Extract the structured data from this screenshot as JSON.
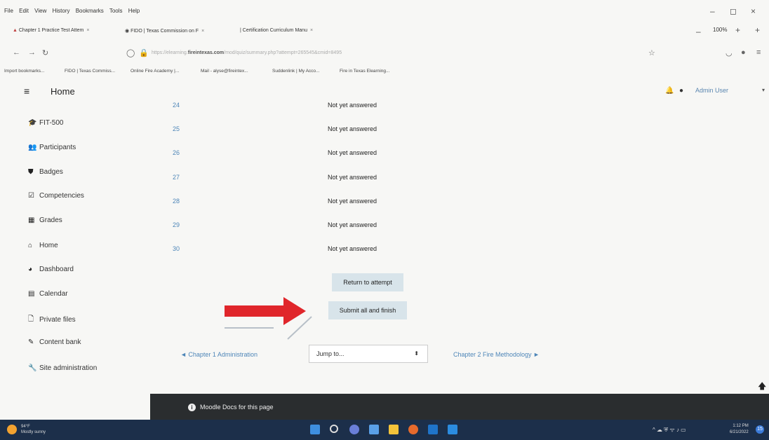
{
  "browser": {
    "menu": [
      "File",
      "Edit",
      "View",
      "History",
      "Bookmarks",
      "Tools",
      "Help"
    ],
    "tabs": [
      {
        "label": "Chapter 1 Practice Test Attem"
      },
      {
        "label": "FIDO | Texas Commission on F"
      },
      {
        "label": "Certification Curriculum Manu"
      }
    ],
    "zoom": "100%",
    "url_prefix": "https://elearning.",
    "url_domain": "fireintexas.com",
    "url_path": "/mod/quiz/summary.php?attempt=265545&cmid=8495",
    "bookmarks": [
      "Import bookmarks...",
      "FIDO | Texas Commiss...",
      "Online Fire Academy |...",
      "Mail - alyse@fireintex...",
      "Suddenlink | My Acco...",
      "Fire in Texas Elearning..."
    ]
  },
  "header": {
    "title": "Home",
    "user": "Admin User"
  },
  "sidebar": {
    "items": [
      {
        "label": "FIT-500",
        "icon": "graduation-cap-icon",
        "glyph": "🎓"
      },
      {
        "label": "Participants",
        "icon": "users-icon",
        "glyph": "👥"
      },
      {
        "label": "Badges",
        "icon": "shield-icon",
        "glyph": "⛊"
      },
      {
        "label": "Competencies",
        "icon": "checkbox-icon",
        "glyph": "☑"
      },
      {
        "label": "Grades",
        "icon": "table-icon",
        "glyph": "▦"
      },
      {
        "label": "Home",
        "icon": "home-icon",
        "glyph": "⌂"
      },
      {
        "label": "Dashboard",
        "icon": "dashboard-icon",
        "glyph": "◕"
      },
      {
        "label": "Calendar",
        "icon": "calendar-icon",
        "glyph": "▤"
      },
      {
        "label": "Private files",
        "icon": "file-icon",
        "glyph": "🗋"
      },
      {
        "label": "Content bank",
        "icon": "brush-icon",
        "glyph": "✎"
      },
      {
        "label": "Site administration",
        "icon": "wrench-icon",
        "glyph": "🔧"
      }
    ]
  },
  "summary": {
    "rows": [
      {
        "num": "24",
        "status": "Not yet answered"
      },
      {
        "num": "25",
        "status": "Not yet answered"
      },
      {
        "num": "26",
        "status": "Not yet answered"
      },
      {
        "num": "27",
        "status": "Not yet answered"
      },
      {
        "num": "28",
        "status": "Not yet answered"
      },
      {
        "num": "29",
        "status": "Not yet answered"
      },
      {
        "num": "30",
        "status": "Not yet answered"
      }
    ],
    "return_label": "Return to attempt",
    "submit_label": "Submit all and finish"
  },
  "activity_nav": {
    "prev": "◄ Chapter 1 Administration",
    "jump_placeholder": "Jump to...",
    "next": "Chapter 2 Fire Methodology ►"
  },
  "footer": {
    "docs_link": "Moodle Docs for this page"
  },
  "taskbar": {
    "temp": "94°F",
    "weather": "Mostly sunny",
    "time": "1:12 PM",
    "date": "6/21/2022",
    "notifications": "15"
  },
  "colors": {
    "link": "#4e86b8",
    "button_bg": "#d8e4ea",
    "arrow": "#e0262b",
    "footer_bg": "#2a2d2f",
    "taskbar_bg": "#1c2f4a"
  }
}
